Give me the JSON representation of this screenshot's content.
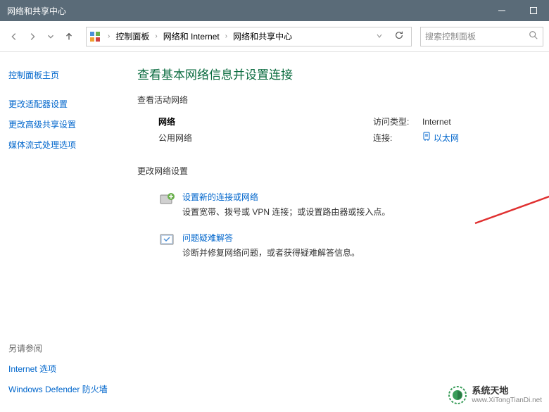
{
  "titlebar": {
    "title": "网络和共享中心"
  },
  "breadcrumb": {
    "items": [
      "控制面板",
      "网络和 Internet",
      "网络和共享中心"
    ]
  },
  "search": {
    "placeholder": "搜索控制面板"
  },
  "sidebar": {
    "home": "控制面板主页",
    "links": [
      "更改适配器设置",
      "更改高级共享设置",
      "媒体流式处理选项"
    ],
    "see_also_heading": "另请参阅",
    "see_also": [
      "Internet 选项",
      "Windows Defender 防火墙"
    ]
  },
  "main": {
    "title": "查看基本网络信息并设置连接",
    "active_networks_heading": "查看活动网络",
    "network": {
      "name": "网络",
      "type": "公用网络",
      "access_type_label": "访问类型:",
      "access_type_value": "Internet",
      "connection_label": "连接:",
      "connection_value": "以太网"
    },
    "change_settings_heading": "更改网络设置",
    "settings": [
      {
        "link": "设置新的连接或网络",
        "desc": "设置宽带、拨号或 VPN 连接；或设置路由器或接入点。"
      },
      {
        "link": "问题疑难解答",
        "desc": "诊断并修复网络问题，或者获得疑难解答信息。"
      }
    ]
  },
  "watermark": {
    "name": "系统天地",
    "url": "www.XiTongTianDi.net"
  }
}
